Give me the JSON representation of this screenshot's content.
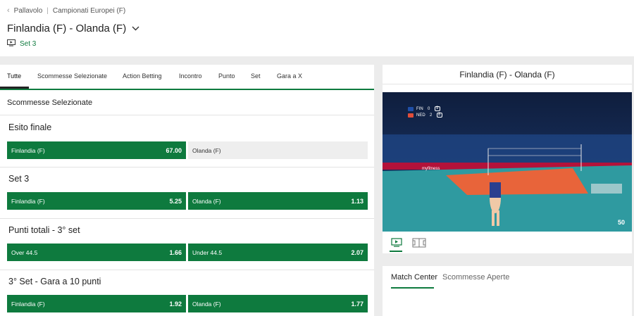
{
  "breadcrumb": {
    "sport": "Pallavolo",
    "competition": "Campionati Europei (F)"
  },
  "event": {
    "title": "Finlandia (F) - Olanda (F)",
    "status": "Set 3"
  },
  "tabs": [
    "Tutte",
    "Scommesse Selezionate",
    "Action Betting",
    "Incontro",
    "Punto",
    "Set",
    "Gara a X"
  ],
  "section_label": "Scommesse Selezionate",
  "markets": [
    {
      "title": "Esito finale",
      "options": [
        {
          "label": "Finlandia (F)",
          "odds": "67.00"
        },
        {
          "label": "Olanda (F)",
          "odds": ""
        }
      ]
    },
    {
      "title": "Set 3",
      "options": [
        {
          "label": "Finlandia (F)",
          "odds": "5.25"
        },
        {
          "label": "Olanda (F)",
          "odds": "1.13"
        }
      ]
    },
    {
      "title": "Punti totali - 3° set",
      "options": [
        {
          "label": "Over 44.5",
          "odds": "1.66"
        },
        {
          "label": "Under 44.5",
          "odds": "2.07"
        }
      ]
    },
    {
      "title": "3° Set - Gara a 10 punti",
      "options": [
        {
          "label": "Finlandia (F)",
          "odds": "1.92"
        },
        {
          "label": "Olanda (F)",
          "odds": "1.77"
        }
      ]
    }
  ],
  "stream": {
    "title": "Finlandia (F) - Olanda (F)",
    "scoreboard": [
      {
        "team": "FIN",
        "sets": "0",
        "points": "9"
      },
      {
        "team": "NED",
        "sets": "2",
        "points": "8"
      }
    ],
    "ad_text": "myfitness",
    "watermark": "50"
  },
  "bottom_tabs": [
    "Match Center",
    "Scommesse Aperte"
  ],
  "colors": {
    "accent": "#0e7a3e",
    "court_orange": "#e8643a",
    "court_teal": "#2f9aa0"
  },
  "icons": [
    "chevron-left-icon",
    "chevron-down-icon",
    "live-stream-icon",
    "video-view-icon",
    "field-view-icon"
  ]
}
